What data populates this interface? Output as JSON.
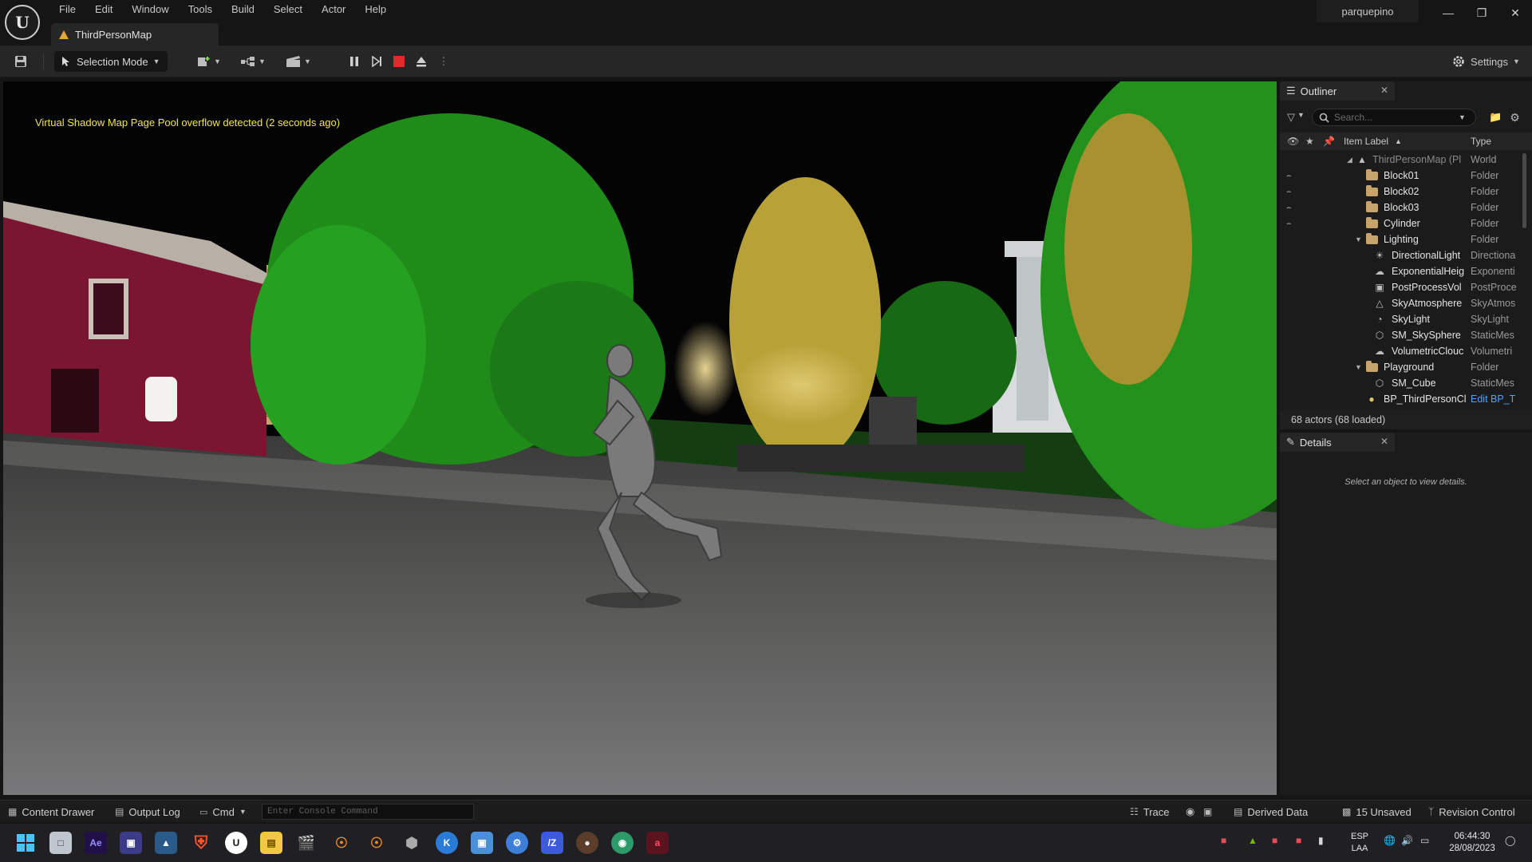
{
  "menu": {
    "items": [
      "File",
      "Edit",
      "Window",
      "Tools",
      "Build",
      "Select",
      "Actor",
      "Help"
    ]
  },
  "document_tab": {
    "label": "ThirdPersonMap"
  },
  "user": {
    "name": "parquepino"
  },
  "toolbar": {
    "selection_mode": "Selection Mode",
    "settings": "Settings"
  },
  "viewport": {
    "warning": "Virtual Shadow Map Page Pool overflow detected (2 seconds ago)"
  },
  "outliner": {
    "title": "Outliner",
    "search_placeholder": "Search...",
    "columns": {
      "label": "Item Label",
      "type": "Type"
    },
    "rows": [
      {
        "label": "ThirdPersonMap (Pl",
        "type": "World"
      },
      {
        "label": "Block01",
        "type": "Folder"
      },
      {
        "label": "Block02",
        "type": "Folder"
      },
      {
        "label": "Block03",
        "type": "Folder"
      },
      {
        "label": "Cylinder",
        "type": "Folder"
      },
      {
        "label": "Lighting",
        "type": "Folder"
      },
      {
        "label": "DirectionalLight",
        "type": "Directiona"
      },
      {
        "label": "ExponentialHeig",
        "type": "Exponenti"
      },
      {
        "label": "PostProcessVol",
        "type": "PostProce"
      },
      {
        "label": "SkyAtmosphere",
        "type": "SkyAtmos"
      },
      {
        "label": "SkyLight",
        "type": "SkyLight"
      },
      {
        "label": "SM_SkySphere",
        "type": "StaticMes"
      },
      {
        "label": "VolumetricClouc",
        "type": "Volumetri"
      },
      {
        "label": "Playground",
        "type": "Folder"
      },
      {
        "label": "SM_Cube",
        "type": "StaticMes"
      },
      {
        "label": "BP_ThirdPersonCl",
        "type": "Edit BP_T"
      }
    ],
    "actor_count": "68 actors (68 loaded)"
  },
  "details": {
    "title": "Details",
    "empty_message": "Select an object to view details."
  },
  "statusbar": {
    "content_drawer": "Content Drawer",
    "output_log": "Output Log",
    "cmd": "Cmd",
    "console_placeholder": "Enter Console Command",
    "trace": "Trace",
    "derived_data": "Derived Data",
    "unsaved": "15 Unsaved",
    "revision_control": "Revision Control"
  },
  "taskbar": {
    "lang_1": "ESP",
    "lang_2": "LAA",
    "time": "06:44:30",
    "date": "28/08/2023",
    "apps": [
      "windows-start",
      "file-explorer-alt",
      "after-effects",
      "app-purple",
      "app-photos",
      "brave",
      "unreal-engine",
      "file-explorer",
      "clapper",
      "blender",
      "blender-alt",
      "app-dark",
      "app-k",
      "app-screen",
      "settings",
      "app-z",
      "app-brown",
      "app-globe",
      "app-red"
    ]
  },
  "colors": {
    "warning_text": "#f2e648",
    "stop_button": "#e02b2b",
    "folder": "#c8a46a",
    "edit_link": "#4da3ff"
  }
}
